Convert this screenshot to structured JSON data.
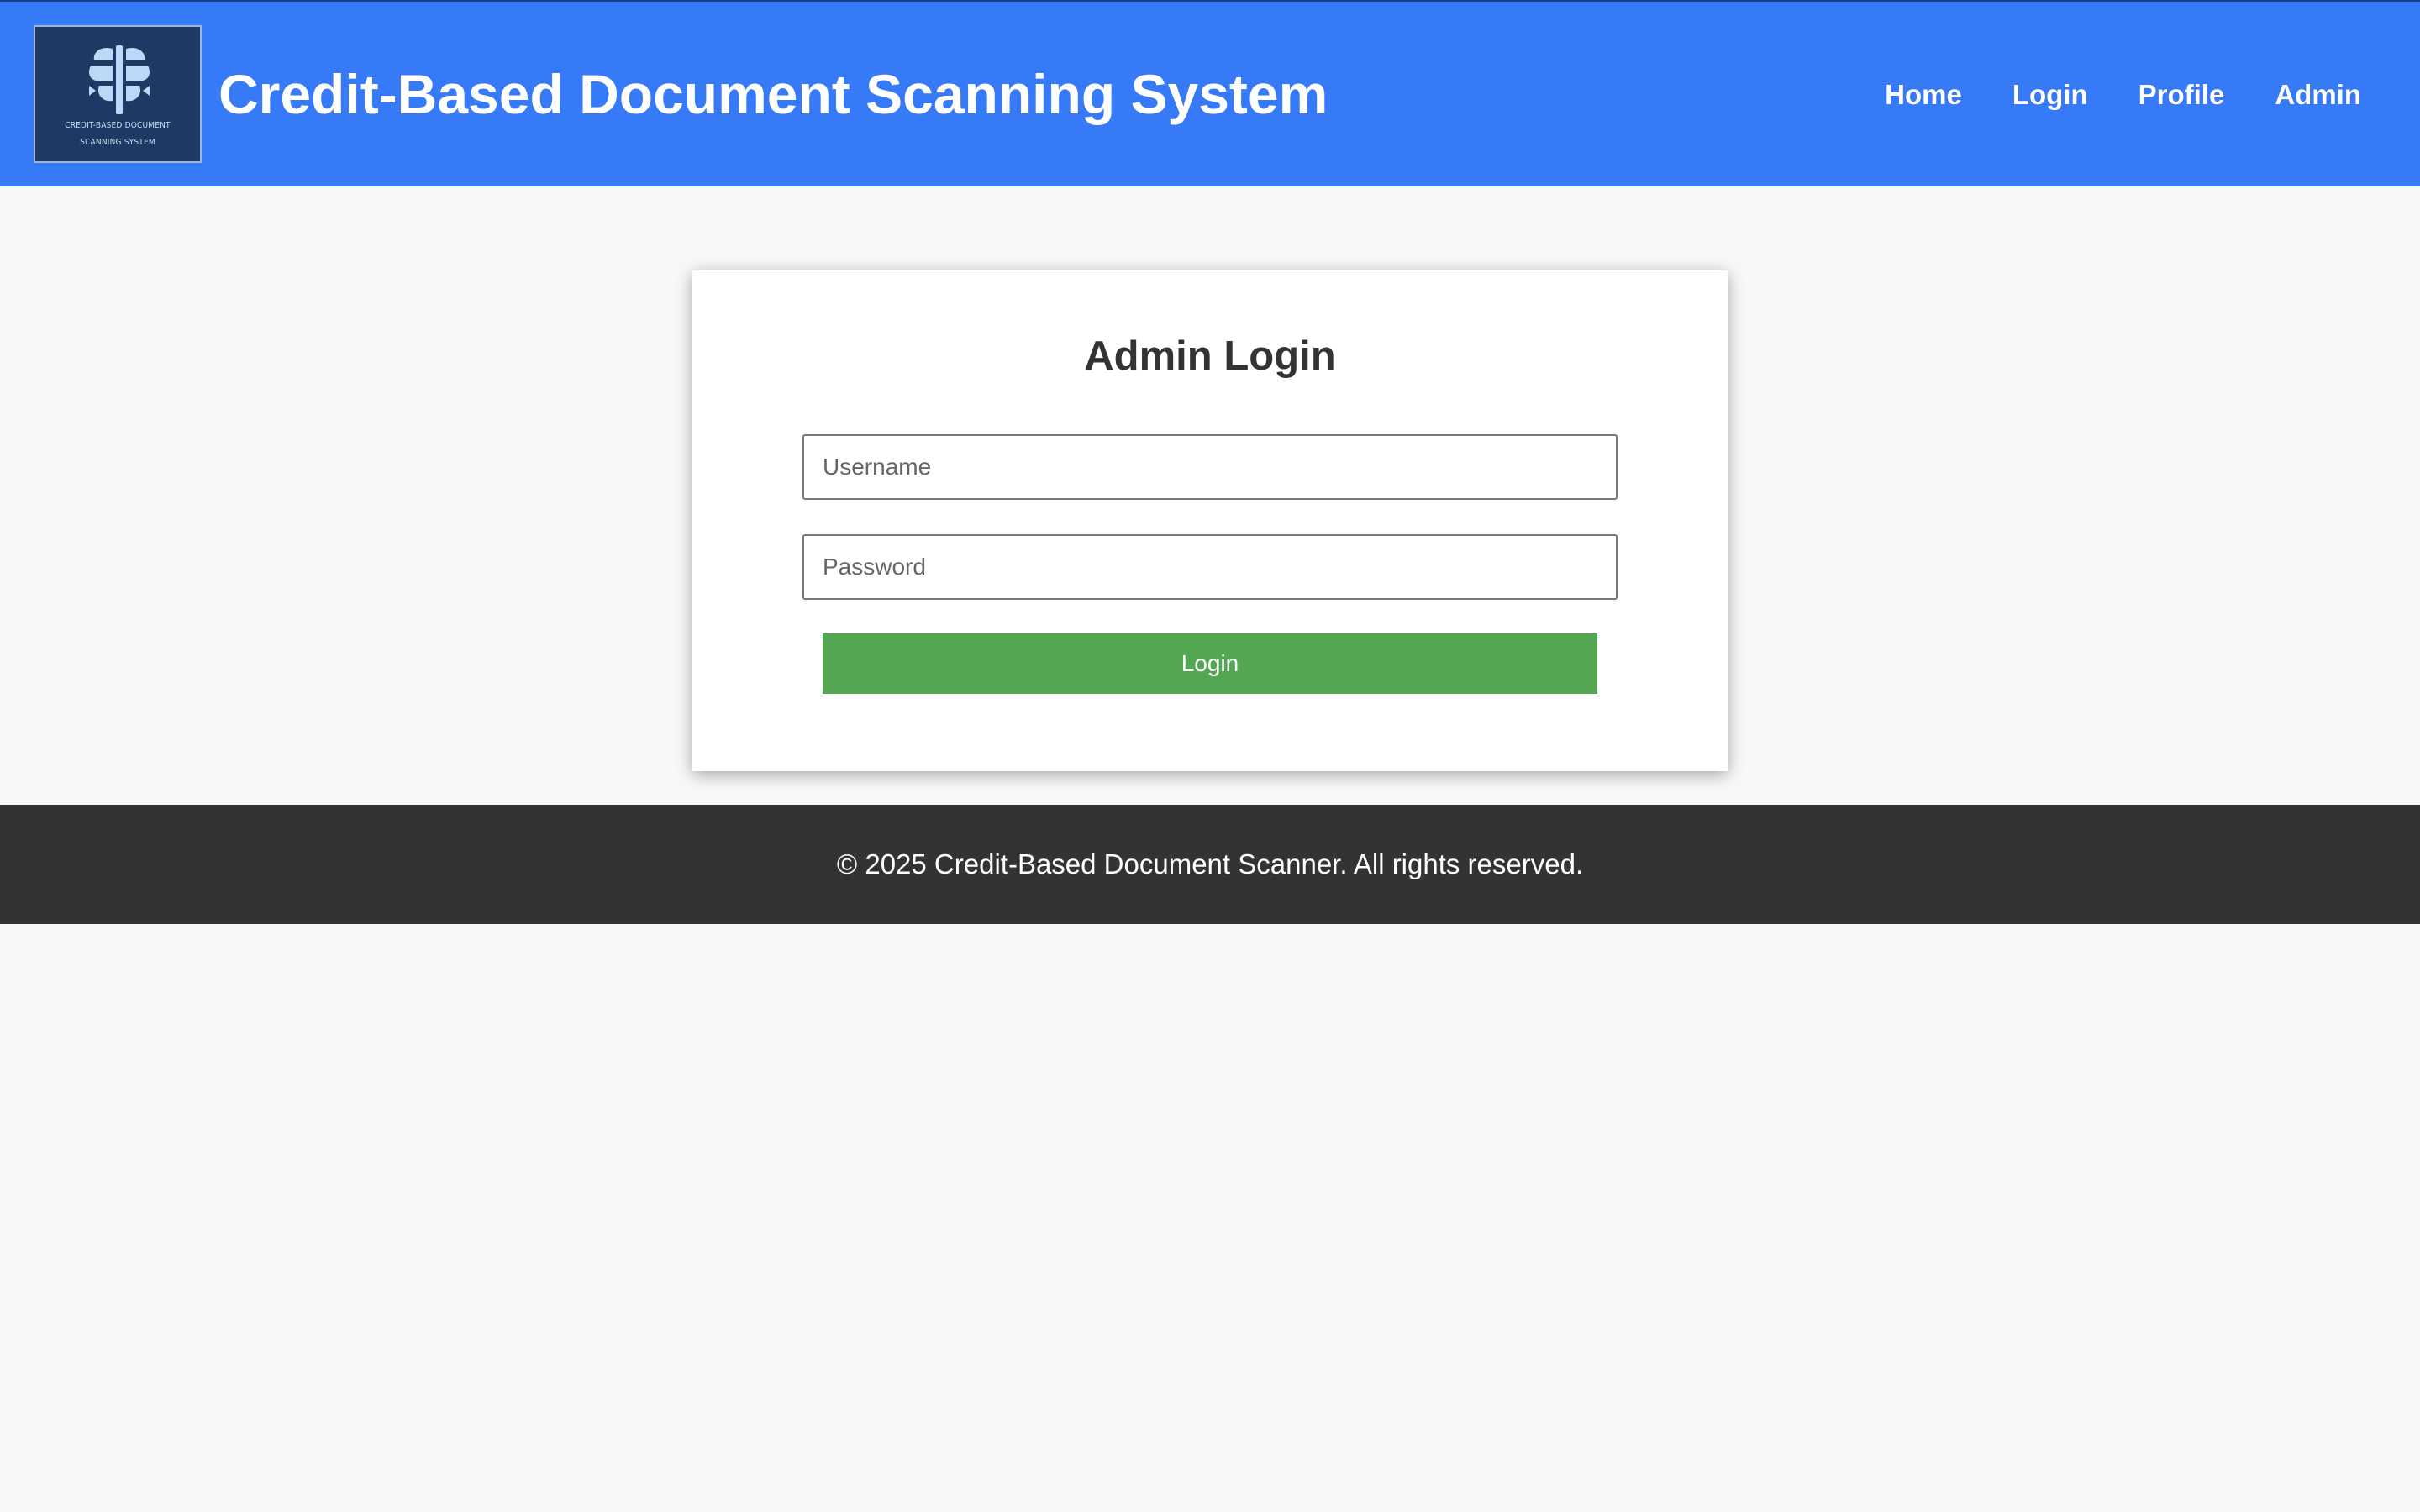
{
  "header": {
    "logo": {
      "line1": "CREDIT-BASED DOCUMENT",
      "line2": "SCANNING SYSTEM",
      "icon": "brain-icon"
    },
    "title": "Credit-Based Document Scanning System",
    "nav": [
      "Home",
      "Login",
      "Profile",
      "Admin"
    ]
  },
  "login": {
    "title": "Admin Login",
    "username_placeholder": "Username",
    "username_value": "",
    "password_placeholder": "Password",
    "password_value": "",
    "submit_label": "Login"
  },
  "footer": {
    "text": "© 2025 Credit-Based Document Scanner. All rights reserved."
  },
  "colors": {
    "header_bg": "#377af8",
    "logo_bg": "#1e3a64",
    "button_bg": "#53a752",
    "footer_bg": "#333333",
    "page_bg": "#f8f8f8"
  }
}
